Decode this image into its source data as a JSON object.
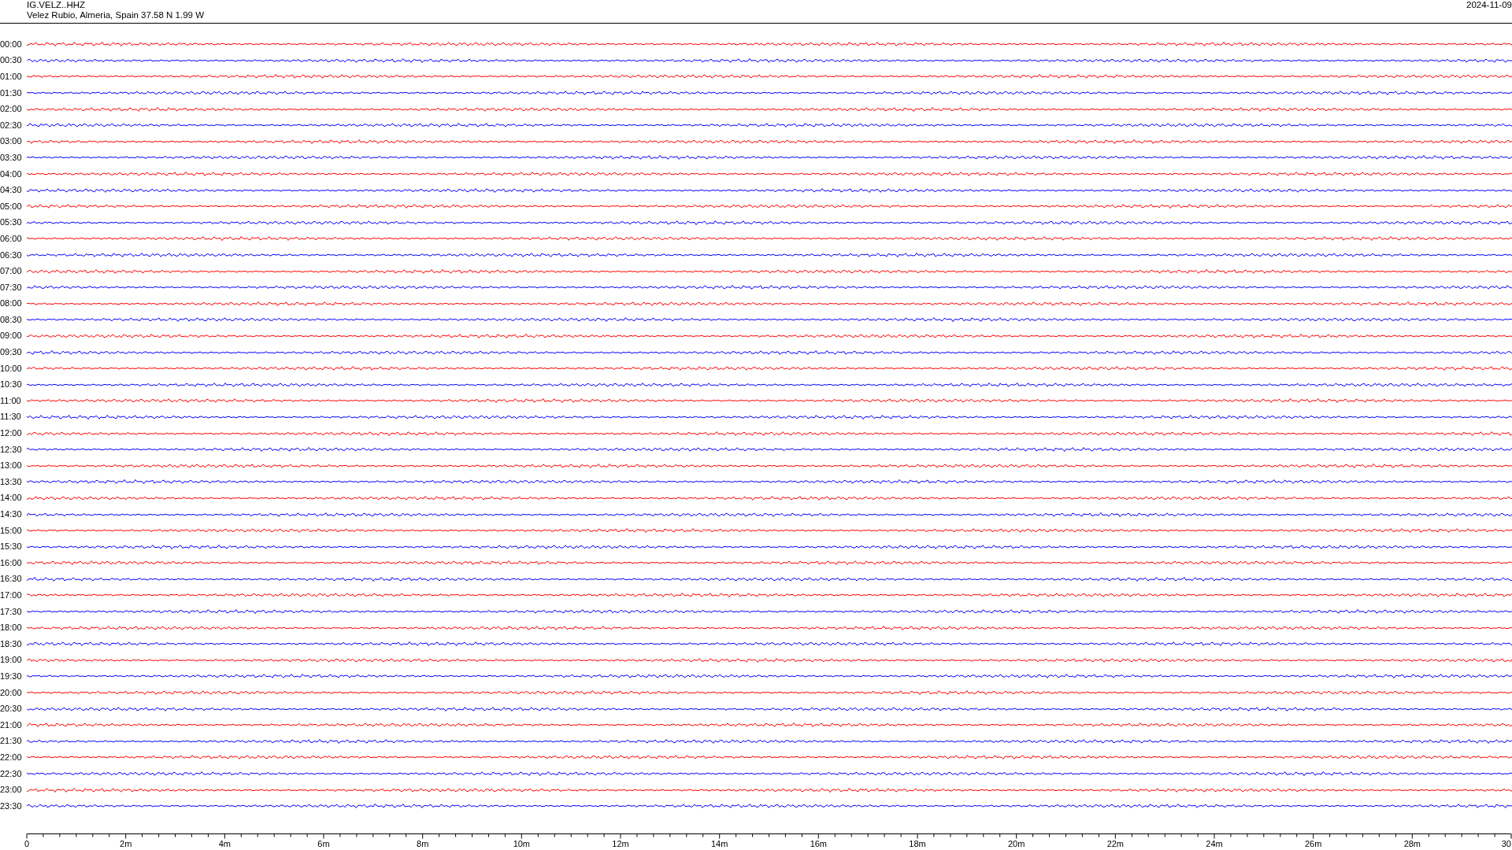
{
  "header": {
    "station": "IG.VELZ..HHZ",
    "location": "Velez Rubio, Almeria, Spain  37.58 N 1.99 W",
    "date": "2024-11-09"
  },
  "traces": [
    {
      "time": "00:00",
      "color": "#ff0000"
    },
    {
      "time": "00:30",
      "color": "#0000ff"
    },
    {
      "time": "01:00",
      "color": "#ff0000"
    },
    {
      "time": "01:30",
      "color": "#0000ff"
    },
    {
      "time": "02:00",
      "color": "#ff0000"
    },
    {
      "time": "02:30",
      "color": "#0000ff"
    },
    {
      "time": "03:00",
      "color": "#ff0000"
    },
    {
      "time": "03:30",
      "color": "#0000ff"
    },
    {
      "time": "04:00",
      "color": "#ff0000"
    },
    {
      "time": "04:30",
      "color": "#0000ff"
    },
    {
      "time": "05:00",
      "color": "#ff0000"
    },
    {
      "time": "05:30",
      "color": "#0000ff"
    },
    {
      "time": "06:00",
      "color": "#ff0000"
    },
    {
      "time": "06:30",
      "color": "#0000ff"
    },
    {
      "time": "07:00",
      "color": "#ff0000"
    },
    {
      "time": "07:30",
      "color": "#0000ff"
    },
    {
      "time": "08:00",
      "color": "#ff0000"
    },
    {
      "time": "08:30",
      "color": "#0000ff"
    },
    {
      "time": "09:00",
      "color": "#ff0000"
    },
    {
      "time": "09:30",
      "color": "#0000ff"
    },
    {
      "time": "10:00",
      "color": "#ff0000"
    },
    {
      "time": "10:30",
      "color": "#0000ff"
    },
    {
      "time": "11:00",
      "color": "#ff0000"
    },
    {
      "time": "11:30",
      "color": "#0000ff"
    },
    {
      "time": "12:00",
      "color": "#ff0000"
    },
    {
      "time": "12:30",
      "color": "#0000ff"
    },
    {
      "time": "13:00",
      "color": "#ff0000"
    },
    {
      "time": "13:30",
      "color": "#0000ff"
    },
    {
      "time": "14:00",
      "color": "#ff0000"
    },
    {
      "time": "14:30",
      "color": "#0000ff"
    },
    {
      "time": "15:00",
      "color": "#ff0000"
    },
    {
      "time": "15:30",
      "color": "#0000ff"
    },
    {
      "time": "16:00",
      "color": "#ff0000"
    },
    {
      "time": "16:30",
      "color": "#0000ff"
    },
    {
      "time": "17:00",
      "color": "#ff0000"
    },
    {
      "time": "17:30",
      "color": "#0000ff"
    },
    {
      "time": "18:00",
      "color": "#ff0000"
    },
    {
      "time": "18:30",
      "color": "#0000ff"
    },
    {
      "time": "19:00",
      "color": "#ff0000"
    },
    {
      "time": "19:30",
      "color": "#0000ff"
    },
    {
      "time": "20:00",
      "color": "#ff0000"
    },
    {
      "time": "20:30",
      "color": "#0000ff"
    },
    {
      "time": "21:00",
      "color": "#ff0000"
    },
    {
      "time": "21:30",
      "color": "#0000ff"
    },
    {
      "time": "22:00",
      "color": "#ff0000"
    },
    {
      "time": "22:30",
      "color": "#0000ff"
    },
    {
      "time": "23:00",
      "color": "#ff0000"
    },
    {
      "time": "23:30",
      "color": "#0000ff"
    }
  ],
  "axis": {
    "labels": [
      "0",
      "2m",
      "4m",
      "6m",
      "8m",
      "10m",
      "12m",
      "14m",
      "16m",
      "18m",
      "20m",
      "22m",
      "24m",
      "26m",
      "28m",
      "30"
    ]
  }
}
